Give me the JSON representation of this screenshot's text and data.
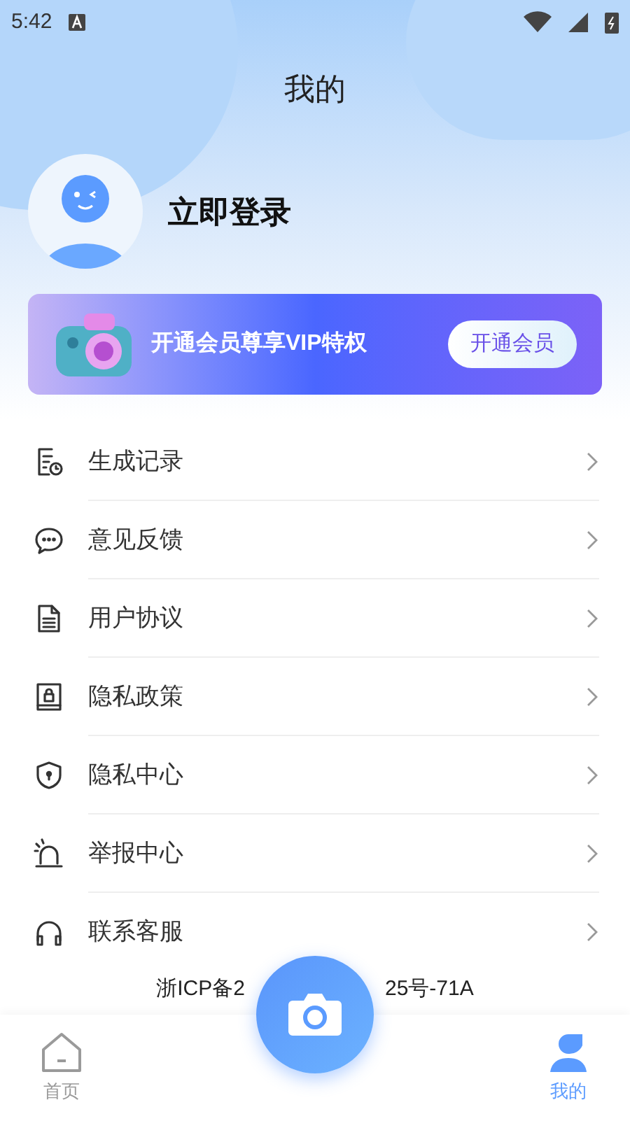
{
  "status_bar": {
    "time": "5:42"
  },
  "header": {
    "title": "我的"
  },
  "profile": {
    "login": "立即登录"
  },
  "vip_banner": {
    "text": "开通会员尊享VIP特权",
    "button": "开通会员"
  },
  "menu": [
    {
      "kind": "history",
      "label": "生成记录"
    },
    {
      "kind": "feedback",
      "label": "意见反馈"
    },
    {
      "kind": "agreement",
      "label": "用户协议"
    },
    {
      "kind": "privacy",
      "label": "隐私政策"
    },
    {
      "kind": "shield",
      "label": "隐私中心"
    },
    {
      "kind": "alarm",
      "label": "举报中心"
    },
    {
      "kind": "headset",
      "label": "联系客服"
    }
  ],
  "icp": {
    "left": "浙ICP备2",
    "right": "25号-71A"
  },
  "tabs": [
    {
      "kind": "home",
      "label": "首页",
      "selected": false
    },
    {
      "kind": "camera",
      "selected": false
    },
    {
      "kind": "me",
      "label": "我的",
      "selected": true
    }
  ]
}
